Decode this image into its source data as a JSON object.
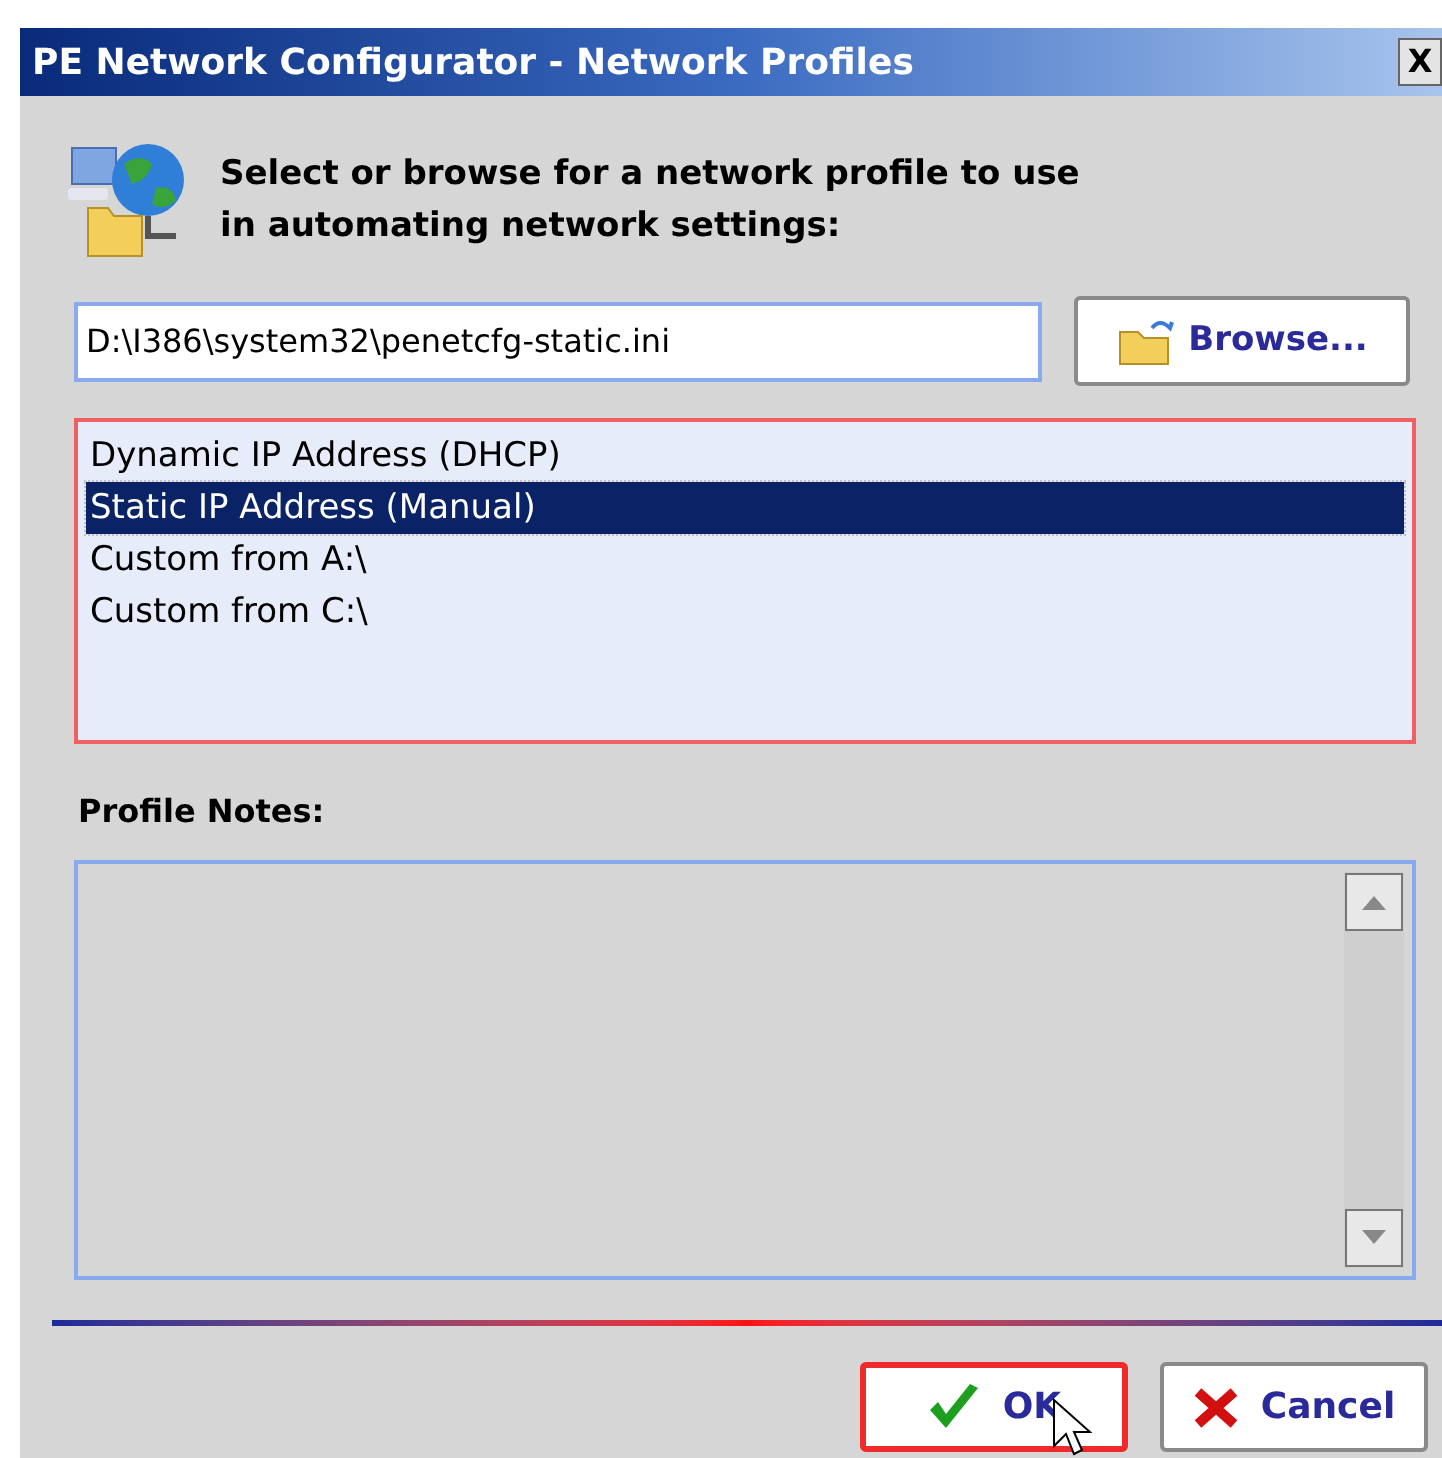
{
  "window": {
    "title": "PE Network Configurator - Network Profiles",
    "close": "X"
  },
  "header": {
    "text": "Select or browse for a network profile to use in automating network settings:"
  },
  "path_field": {
    "value": "D:\\I386\\system32\\penetcfg-static.ini"
  },
  "browse_button": {
    "label": "Browse..."
  },
  "profiles": [
    {
      "label": "Dynamic IP Address (DHCP)",
      "selected": false
    },
    {
      "label": "Static IP Address (Manual)",
      "selected": true
    },
    {
      "label": "Custom from A:\\",
      "selected": false
    },
    {
      "label": "Custom from C:\\",
      "selected": false
    }
  ],
  "notes": {
    "label": "Profile Notes:"
  },
  "buttons": [
    {
      "kind": "ok",
      "label": "OK",
      "focused": true
    },
    {
      "kind": "cancel",
      "label": "Cancel",
      "focused": false
    }
  ]
}
